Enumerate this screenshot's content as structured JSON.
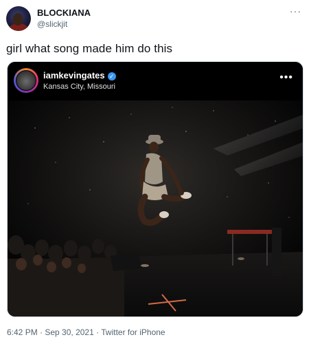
{
  "author": {
    "name": "BLOCKIANA",
    "handle": "@slickjit",
    "avatar_icon": "profile-avatar"
  },
  "tweet": {
    "text": "girl what song made him do this",
    "more_icon": "···"
  },
  "embed": {
    "username": "iamkevingates",
    "verified_icon": "✓",
    "location": "Kansas City, Missouri",
    "more_icon": "•••"
  },
  "meta": {
    "time": "6:42 PM",
    "sep1": " · ",
    "date": "Sep 30, 2021",
    "sep2": " · ",
    "source": "Twitter for iPhone"
  },
  "colors": {
    "text_primary": "#0f1419",
    "text_secondary": "#536471",
    "verified_blue": "#3897f0",
    "stage_spotlight": "#c9b89a"
  }
}
